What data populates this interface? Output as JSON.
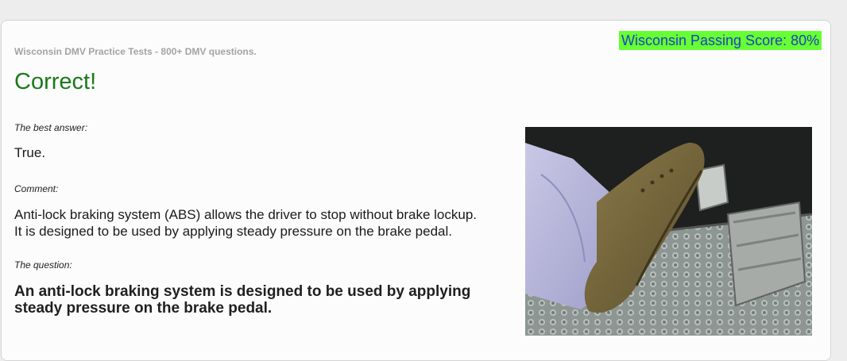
{
  "header": {
    "site_title": "Wisconsin DMV Practice Tests - 800+ DMV questions.",
    "passing_score": "Wisconsin Passing Score: 80%"
  },
  "result": {
    "status": "Correct!"
  },
  "answer_section": {
    "label": "The best answer:",
    "value": "True."
  },
  "comment_section": {
    "label": "Comment:",
    "lines": [
      "Anti-lock braking system (ABS) allows the driver to stop without brake lockup.",
      "It is designed to be used by applying steady pressure on the brake pedal."
    ]
  },
  "question_section": {
    "label": "The question:",
    "lines": [
      "An anti-lock braking system is designed to be used by applying",
      "steady pressure on the brake pedal."
    ]
  },
  "image": {
    "subject": "foot-on-brake-pedal-photo"
  },
  "colors": {
    "correct": "#1a7a1a",
    "score_badge_bg": "#66ff33",
    "score_badge_text": "#1f3fbf",
    "muted": "#a3a3a3"
  }
}
